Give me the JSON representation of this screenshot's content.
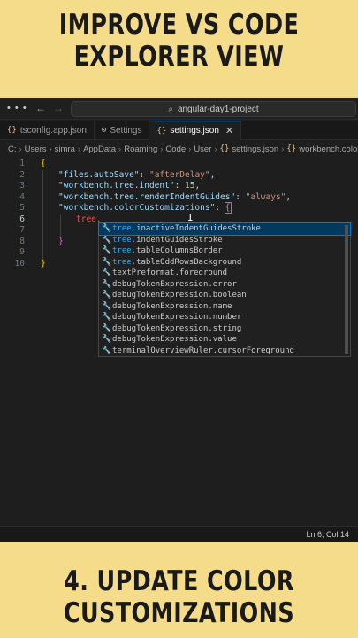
{
  "banner_top": {
    "line1": "IMPROVE VS CODE",
    "line2": "EXPLORER VIEW"
  },
  "banner_bottom": {
    "line1": "4. UPDATE  COLOR",
    "line2": "CUSTOMIZATIONS"
  },
  "titlebar": {
    "search_text": "angular-day1-project"
  },
  "tabs": [
    {
      "label": "tsconfig.app.json",
      "icon": "{}"
    },
    {
      "label": "Settings",
      "icon": "gear"
    },
    {
      "label": "settings.json",
      "icon": "{}"
    }
  ],
  "breadcrumb": [
    "C:",
    "Users",
    "simra",
    "AppData",
    "Roaming",
    "Code",
    "User",
    "settings.json",
    "workbench.colorCustomizations"
  ],
  "editor": {
    "line_numbers": [
      "1",
      "2",
      "3",
      "4",
      "5",
      "6",
      "7",
      "8",
      "9",
      "10"
    ],
    "autosave_key": "\"files.autoSave\"",
    "autosave_val": "\"afterDelay\"",
    "indent_key": "\"workbench.tree.indent\"",
    "indent_val": "15",
    "guides_key": "\"workbench.tree.renderIndentGuides\"",
    "guides_val": "\"always\"",
    "color_key": "\"workbench.colorCustomizations\"",
    "typed_text": "tree."
  },
  "suggestions": [
    "tree.inactiveIndentGuidesStroke",
    "tree.indentGuidesStroke",
    "tree.tableColumnsBorder",
    "tree.tableOddRowsBackground",
    "textPreformat.foreground",
    "debugTokenExpression.error",
    "debugTokenExpression.boolean",
    "debugTokenExpression.name",
    "debugTokenExpression.number",
    "debugTokenExpression.string",
    "debugTokenExpression.value",
    "terminalOverviewRuler.cursorForeground"
  ],
  "status": {
    "position": "Ln 6, Col 14"
  }
}
